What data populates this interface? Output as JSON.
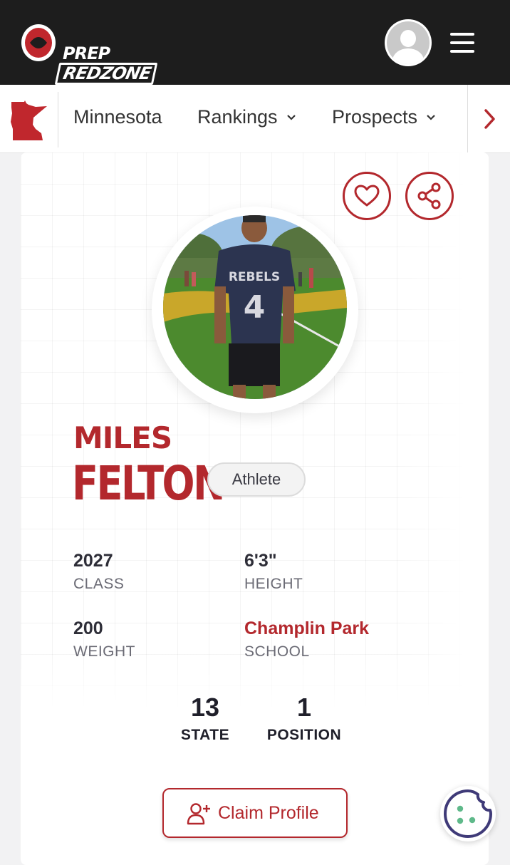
{
  "header": {
    "logo_top": "PREP",
    "logo_bottom": "REDZONE",
    "avatar_icon": "user-avatar-icon",
    "menu_icon": "hamburger-menu-icon"
  },
  "nav": {
    "state_icon": "minnesota-state-icon",
    "items": [
      {
        "label": "Minnesota",
        "dropdown": false
      },
      {
        "label": "Rankings",
        "dropdown": true
      },
      {
        "label": "Prospects",
        "dropdown": true
      }
    ],
    "next_icon": "chevron-right-icon"
  },
  "profile": {
    "first_name": "MILES",
    "last_name": "FELTON",
    "position": "Athlete",
    "stats": [
      {
        "value": "2027",
        "label": "CLASS"
      },
      {
        "value": "6'3\"",
        "label": "HEIGHT"
      },
      {
        "value": "200",
        "label": "WEIGHT"
      },
      {
        "value": "Champlin Park",
        "label": "SCHOOL"
      }
    ],
    "rankings": [
      {
        "value": "13",
        "label": "STATE"
      },
      {
        "value": "1",
        "label": "POSITION"
      }
    ],
    "claim_label": "Claim Profile"
  },
  "colors": {
    "brand_red": "#b3282d",
    "header_bg": "#1d1d1d",
    "cookie_purple": "#3f3a78",
    "cookie_dots": "#5fb98a"
  }
}
